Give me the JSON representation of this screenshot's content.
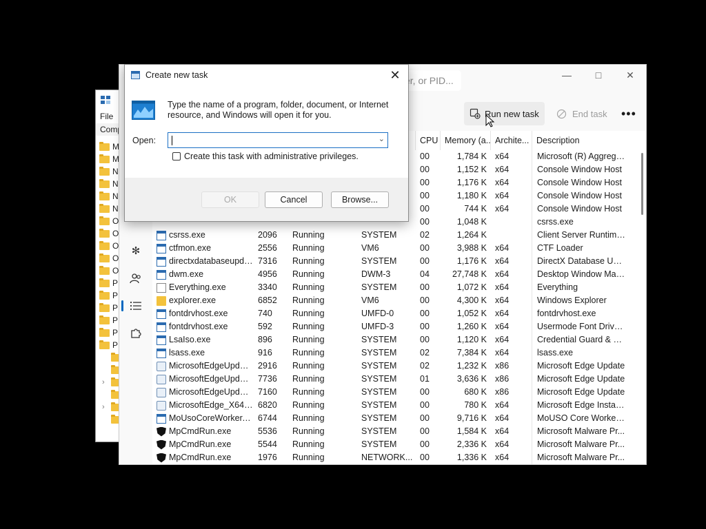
{
  "explorer": {
    "menu_file": "File",
    "address_partial": "Comp",
    "rows": [
      {
        "label": "M",
        "tree": ""
      },
      {
        "label": "M",
        "tree": ""
      },
      {
        "label": "N",
        "tree": ""
      },
      {
        "label": "N",
        "tree": ""
      },
      {
        "label": "N",
        "tree": ""
      },
      {
        "label": "N",
        "tree": ""
      },
      {
        "label": "O",
        "tree": ""
      },
      {
        "label": "O",
        "tree": ""
      },
      {
        "label": "O",
        "tree": ""
      },
      {
        "label": "O",
        "tree": ""
      },
      {
        "label": "O",
        "tree": ""
      },
      {
        "label": "P",
        "tree": ""
      },
      {
        "label": "P",
        "tree": ""
      },
      {
        "label": "P",
        "tree": ""
      },
      {
        "label": "P",
        "tree": ""
      },
      {
        "label": "P",
        "tree": ""
      },
      {
        "label": "P",
        "tree": ""
      },
      {
        "label": "",
        "tree": ""
      },
      {
        "label": "",
        "tree": ""
      },
      {
        "label": "",
        "tree": "›"
      },
      {
        "label": "",
        "tree": ""
      },
      {
        "label": "",
        "tree": "›"
      },
      {
        "label": "",
        "tree": ""
      }
    ]
  },
  "task_manager": {
    "search_placeholder": "er, or PID...",
    "toolbar": {
      "run_new_task": "Run new task",
      "end_task": "End task",
      "more": "•••"
    },
    "columns": {
      "cpu": "CPU",
      "memory": "Memory (a...",
      "architecture": "Archite...",
      "description": "Description"
    },
    "processes": [
      {
        "name": "",
        "pid": "",
        "status": "",
        "user": "",
        "cpu": "00",
        "memory": "1,784 K",
        "arch": "x64",
        "desc": "Microsoft (R) Aggrega...",
        "icon": "none"
      },
      {
        "name": "",
        "pid": "",
        "status": "",
        "user": "",
        "cpu": "00",
        "memory": "1,152 K",
        "arch": "x64",
        "desc": "Console Window Host",
        "icon": "none"
      },
      {
        "name": "",
        "pid": "",
        "status": "",
        "user": "",
        "cpu": "00",
        "memory": "1,176 K",
        "arch": "x64",
        "desc": "Console Window Host",
        "icon": "none"
      },
      {
        "name": "",
        "pid": "",
        "status": "",
        "user": "",
        "cpu": "00",
        "memory": "1,180 K",
        "arch": "x64",
        "desc": "Console Window Host",
        "icon": "none"
      },
      {
        "name": "",
        "pid": "",
        "status": "",
        "user": "",
        "cpu": "00",
        "memory": "744 K",
        "arch": "x64",
        "desc": "Console Window Host",
        "icon": "none"
      },
      {
        "name": "",
        "pid": "",
        "status": "",
        "user": "",
        "cpu": "00",
        "memory": "1,048 K",
        "arch": "",
        "desc": "csrss.exe",
        "icon": "none"
      },
      {
        "name": "csrss.exe",
        "pid": "2096",
        "status": "Running",
        "user": "SYSTEM",
        "cpu": "02",
        "memory": "1,264 K",
        "arch": "",
        "desc": "Client Server Runtime ...",
        "icon": "app"
      },
      {
        "name": "ctfmon.exe",
        "pid": "2556",
        "status": "Running",
        "user": "VM6",
        "cpu": "00",
        "memory": "3,988 K",
        "arch": "x64",
        "desc": "CTF Loader",
        "icon": "app"
      },
      {
        "name": "directxdatabaseupda...",
        "pid": "7316",
        "status": "Running",
        "user": "SYSTEM",
        "cpu": "00",
        "memory": "1,176 K",
        "arch": "x64",
        "desc": "DirectX Database Upd...",
        "icon": "app"
      },
      {
        "name": "dwm.exe",
        "pid": "4956",
        "status": "Running",
        "user": "DWM-3",
        "cpu": "04",
        "memory": "27,748 K",
        "arch": "x64",
        "desc": "Desktop Window Man...",
        "icon": "app"
      },
      {
        "name": "Everything.exe",
        "pid": "3340",
        "status": "Running",
        "user": "SYSTEM",
        "cpu": "00",
        "memory": "1,072 K",
        "arch": "x64",
        "desc": "Everything",
        "icon": "file"
      },
      {
        "name": "explorer.exe",
        "pid": "6852",
        "status": "Running",
        "user": "VM6",
        "cpu": "00",
        "memory": "4,300 K",
        "arch": "x64",
        "desc": "Windows Explorer",
        "icon": "folder"
      },
      {
        "name": "fontdrvhost.exe",
        "pid": "740",
        "status": "Running",
        "user": "UMFD-0",
        "cpu": "00",
        "memory": "1,052 K",
        "arch": "x64",
        "desc": "fontdrvhost.exe",
        "icon": "app"
      },
      {
        "name": "fontdrvhost.exe",
        "pid": "592",
        "status": "Running",
        "user": "UMFD-3",
        "cpu": "00",
        "memory": "1,260 K",
        "arch": "x64",
        "desc": "Usermode Font Driver ...",
        "icon": "app"
      },
      {
        "name": "LsaIso.exe",
        "pid": "896",
        "status": "Running",
        "user": "SYSTEM",
        "cpu": "00",
        "memory": "1,120 K",
        "arch": "x64",
        "desc": "Credential Guard & VB...",
        "icon": "app"
      },
      {
        "name": "lsass.exe",
        "pid": "916",
        "status": "Running",
        "user": "SYSTEM",
        "cpu": "02",
        "memory": "7,384 K",
        "arch": "x64",
        "desc": "lsass.exe",
        "icon": "app"
      },
      {
        "name": "MicrosoftEdgeUpdat...",
        "pid": "2916",
        "status": "Running",
        "user": "SYSTEM",
        "cpu": "02",
        "memory": "1,232 K",
        "arch": "x86",
        "desc": "Microsoft Edge Update",
        "icon": "edge"
      },
      {
        "name": "MicrosoftEdgeUpdat...",
        "pid": "7736",
        "status": "Running",
        "user": "SYSTEM",
        "cpu": "01",
        "memory": "3,636 K",
        "arch": "x86",
        "desc": "Microsoft Edge Update",
        "icon": "edge"
      },
      {
        "name": "MicrosoftEdgeUpdat...",
        "pid": "7160",
        "status": "Running",
        "user": "SYSTEM",
        "cpu": "00",
        "memory": "680 K",
        "arch": "x86",
        "desc": "Microsoft Edge Update",
        "icon": "edge"
      },
      {
        "name": "MicrosoftEdge_X64_...",
        "pid": "6820",
        "status": "Running",
        "user": "SYSTEM",
        "cpu": "00",
        "memory": "780 K",
        "arch": "x64",
        "desc": "Microsoft Edge Installer",
        "icon": "edge"
      },
      {
        "name": "MoUsoCoreWorker.e...",
        "pid": "6744",
        "status": "Running",
        "user": "SYSTEM",
        "cpu": "00",
        "memory": "9,716 K",
        "arch": "x64",
        "desc": "MoUSO Core Worker ...",
        "icon": "app"
      },
      {
        "name": "MpCmdRun.exe",
        "pid": "5536",
        "status": "Running",
        "user": "SYSTEM",
        "cpu": "00",
        "memory": "1,584 K",
        "arch": "x64",
        "desc": "Microsoft Malware Pr...",
        "icon": "shield"
      },
      {
        "name": "MpCmdRun.exe",
        "pid": "5544",
        "status": "Running",
        "user": "SYSTEM",
        "cpu": "00",
        "memory": "2,336 K",
        "arch": "x64",
        "desc": "Microsoft Malware Pr...",
        "icon": "shield"
      },
      {
        "name": "MpCmdRun.exe",
        "pid": "1976",
        "status": "Running",
        "user": "NETWORK...",
        "cpu": "00",
        "memory": "1,336 K",
        "arch": "x64",
        "desc": "Microsoft Malware Pr...",
        "icon": "shield"
      }
    ]
  },
  "dialog": {
    "title": "Create new task",
    "description": "Type the name of a program, folder, document, or Internet resource, and Windows will open it for you.",
    "open_label": "Open:",
    "open_value": "",
    "admin_checkbox_label": "Create this task with administrative privileges.",
    "admin_checked": false,
    "ok_label": "OK",
    "cancel_label": "Cancel",
    "browse_label": "Browse..."
  },
  "colors": {
    "accent": "#0067c0",
    "background": "#000000",
    "focus_border": "#1a6fc4"
  }
}
